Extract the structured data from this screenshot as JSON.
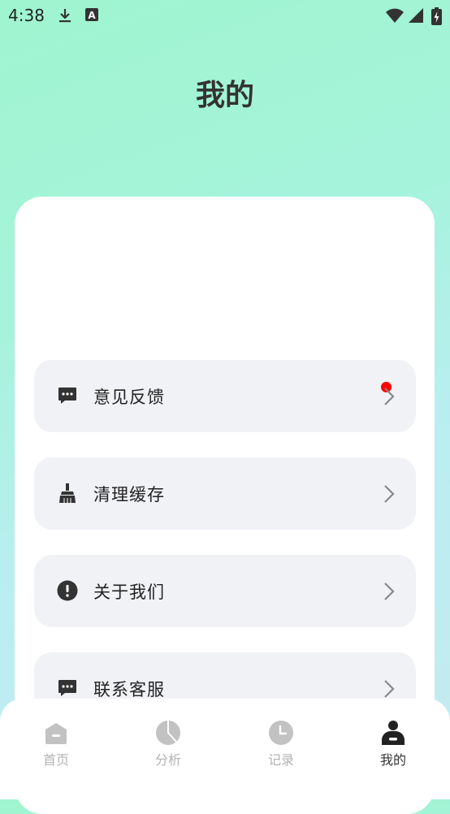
{
  "status_bar": {
    "time": "4:38",
    "icons": [
      "download-icon",
      "keyboard-a-icon",
      "wifi-icon",
      "signal-icon",
      "battery-charging-icon"
    ]
  },
  "page": {
    "title": "我的"
  },
  "menu": {
    "items": [
      {
        "label": "意见反馈",
        "icon": "feedback-chat-icon",
        "has_badge": true
      },
      {
        "label": "清理缓存",
        "icon": "broom-icon"
      },
      {
        "label": "关于我们",
        "icon": "info-alert-icon"
      },
      {
        "label": "联系客服",
        "icon": "chat-icon"
      }
    ]
  },
  "tabbar": {
    "tabs": [
      {
        "label": "首页",
        "icon": "home-icon",
        "active": false
      },
      {
        "label": "分析",
        "icon": "pie-chart-icon",
        "active": false
      },
      {
        "label": "记录",
        "icon": "clock-icon",
        "active": false
      },
      {
        "label": "我的",
        "icon": "user-icon",
        "active": true
      }
    ]
  },
  "colors": {
    "accent_badge": "#ff0000",
    "active_tab": "#333333",
    "inactive_tab": "#b3b3b3",
    "menu_bg": "#f1f2f6"
  }
}
